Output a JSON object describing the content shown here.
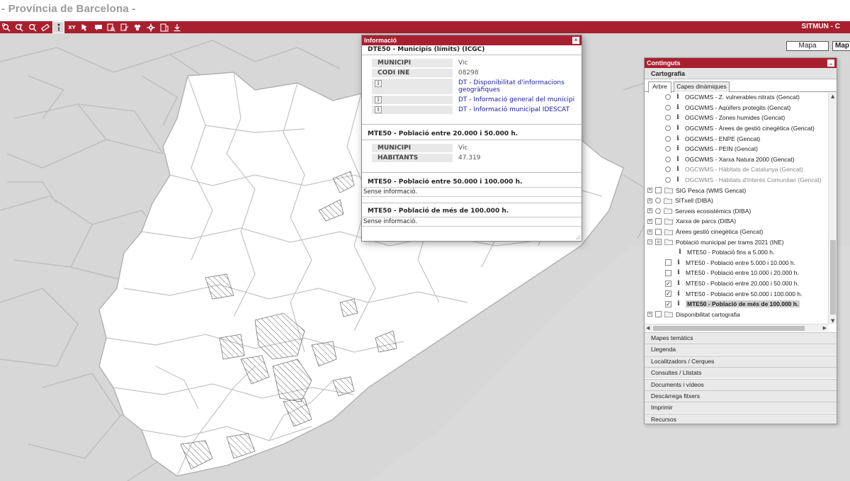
{
  "window": {
    "title": "- Província de Barcelona -"
  },
  "toolbar": {
    "brand": "SITMUN - C",
    "tools": [
      {
        "icon": "zoom-box-icon"
      },
      {
        "icon": "zoom-in-icon"
      },
      {
        "icon": "zoom-out-icon"
      },
      {
        "icon": "measure-icon"
      },
      {
        "icon": "info-icon",
        "active": true
      },
      {
        "icon": "xy-coords-icon",
        "label": "XY"
      },
      {
        "icon": "zoom-xy-icon"
      },
      {
        "icon": "comment-icon"
      },
      {
        "icon": "search-icon"
      },
      {
        "icon": "edit-icon"
      },
      {
        "icon": "layers-icon"
      },
      {
        "icon": "settings-icon"
      },
      {
        "icon": "print-icon"
      },
      {
        "icon": "download-icon"
      }
    ]
  },
  "maptype": {
    "map_label": "Mapa",
    "map2_label": "Map"
  },
  "info": {
    "title": "Informació",
    "layer1": {
      "title": "DTE50 - Municipis (límits) (ICGC)",
      "rows": [
        {
          "key": "MUNICIPI",
          "value": "Vic"
        },
        {
          "key": "CODI INE",
          "value": "08298"
        }
      ],
      "links": [
        {
          "text": "DT - Disponibilitat d'informacions geogràfiques"
        },
        {
          "text": "DT - Informació general del municipi"
        },
        {
          "text": "DT - Informació municipal IDESCAT"
        }
      ]
    },
    "layer2": {
      "title": "MTE50 - Població entre 20.000 i 50.000 h.",
      "rows": [
        {
          "key": "MUNICIPI",
          "value": "Vic"
        },
        {
          "key": "HABITANTS",
          "value": "47.319"
        }
      ]
    },
    "layer3": {
      "title": "MTE50 - Població entre 50.000 i 100.000 h.",
      "noinfo": "Sense informació."
    },
    "layer4": {
      "title": "MTE50 - Població de més de 100.000 h.",
      "noinfo": "Sense informació."
    }
  },
  "panel": {
    "title": "Continguts",
    "subtitle": "Cartografia",
    "tabs": [
      {
        "label": "Arbre"
      },
      {
        "label": "Capes dinàmiques"
      }
    ],
    "tree": [
      {
        "label": "OGCWMS - Z. vulnerables nitrats (Gencat)",
        "type": "radio-info"
      },
      {
        "label": "OGCWMS - Aqüífers protegits (Gencat)",
        "type": "radio-info"
      },
      {
        "label": "OGCWMS - Zones humides (Gencat)",
        "type": "radio-info"
      },
      {
        "label": "OGCWMS - Àrees de gestió cinegètica (Gencat)",
        "type": "radio-info"
      },
      {
        "label": "OGCWMS - ENPE (Gencat)",
        "type": "radio-info"
      },
      {
        "label": "OGCWMS - PEIN (Gencat)",
        "type": "radio-info"
      },
      {
        "label": "OGCWMS - Xarxa Natura 2000 (Gencat)",
        "type": "radio-info"
      },
      {
        "label": "OGCWMS - Hàbitats de Catalunya (Gencat)",
        "type": "radio-info",
        "dim": true
      },
      {
        "label": "OGCWMS - Hàbitats d'Interès Comunitari (Gencat)",
        "type": "radio-info",
        "dim": true
      },
      {
        "label": "SIG Pesca (WMS Gencat)",
        "type": "folder-check"
      },
      {
        "label": "SITxell (DIBA)",
        "type": "folder-radio"
      },
      {
        "label": "Serveis ecosistèmics (DIBA)",
        "type": "folder-radio"
      },
      {
        "label": "Xarxa de parcs (DIBA)",
        "type": "folder-check"
      },
      {
        "label": "Àrees gestió cinegètica (Gencat)",
        "type": "folder-check"
      },
      {
        "label": "Població municipal per trams 2021 (INE)",
        "type": "folder-partial",
        "open": true
      },
      {
        "label": "MTE50 - Població fins a 5.000 h.",
        "type": "leaf",
        "checked": false
      },
      {
        "label": "MTE50 - Població entre 5.000 i 10.000 h.",
        "type": "leaf-check",
        "checked": false
      },
      {
        "label": "MTE50 - Població entre 10.000 i 20.000 h.",
        "type": "leaf-check",
        "checked": false
      },
      {
        "label": "MTE50 - Població entre 20.000 i 50.000 h.",
        "type": "leaf-check",
        "checked": true
      },
      {
        "label": "MTE50 - Població entre 50.000 i 100.000 h.",
        "type": "leaf-check",
        "checked": true
      },
      {
        "label": "MTE50 - Població de més de 100.000 h.",
        "type": "leaf-check",
        "checked": true,
        "selected": true
      },
      {
        "label": "Disponibilitat cartografia",
        "type": "folder-check"
      }
    ],
    "accordion": [
      {
        "label": "Mapes temàtics"
      },
      {
        "label": "Llegenda"
      },
      {
        "label": "Localitzadors / Cerques"
      },
      {
        "label": "Consultes / Llistats"
      },
      {
        "label": "Documents i vídeos"
      },
      {
        "label": "Descàrrega fitxers"
      },
      {
        "label": "Imprimir"
      },
      {
        "label": "Recursos"
      }
    ]
  },
  "colors": {
    "accent": "#a8202f",
    "land": "#ffffff",
    "outside": "#d7d7d7",
    "border": "#b0b0b0"
  }
}
